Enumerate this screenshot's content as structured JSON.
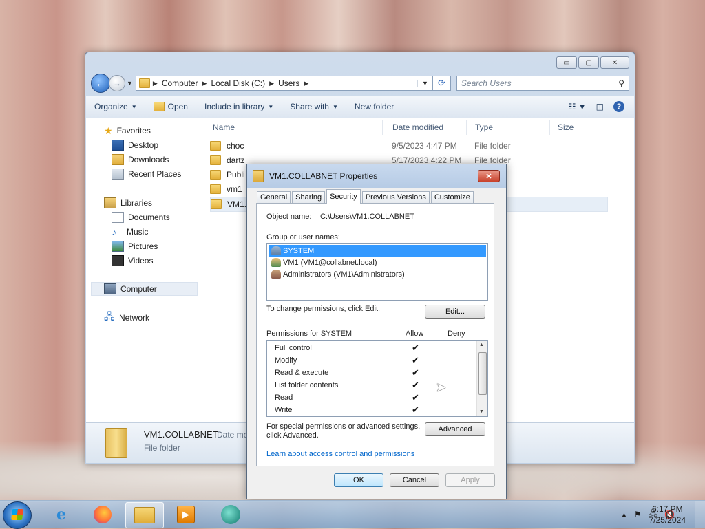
{
  "explorer": {
    "window_buttons": {
      "minimize": "▭",
      "maximize": "▢",
      "close": "✕"
    },
    "address": {
      "segments": [
        "Computer",
        "Local Disk (C:)",
        "Users"
      ]
    },
    "search": {
      "placeholder": "Search Users"
    },
    "toolbar": {
      "organize": "Organize",
      "open": "Open",
      "include_in_library": "Include in library",
      "share_with": "Share with",
      "new_folder": "New folder"
    },
    "nav": {
      "favorites": "Favorites",
      "desktop": "Desktop",
      "downloads": "Downloads",
      "recent_places": "Recent Places",
      "libraries": "Libraries",
      "documents": "Documents",
      "music": "Music",
      "pictures": "Pictures",
      "videos": "Videos",
      "computer": "Computer",
      "network": "Network"
    },
    "columns": {
      "name": "Name",
      "date": "Date modified",
      "type": "Type",
      "size": "Size"
    },
    "files": [
      {
        "name": "choc",
        "date": "9/5/2023 4:47 PM",
        "type": "File folder"
      },
      {
        "name": "dartz",
        "date": "5/17/2023 4:22 PM",
        "type": "File folder"
      },
      {
        "name": "Publi",
        "date": "",
        "type": "er"
      },
      {
        "name": "vm1",
        "date": "",
        "type": "er"
      },
      {
        "name": "VM1.C",
        "date": "",
        "type": "er"
      }
    ],
    "details": {
      "name": "VM1.COLLABNET",
      "date_label": "Date mo",
      "type": "File folder"
    }
  },
  "dialog": {
    "title": "VM1.COLLABNET Properties",
    "close": "✕",
    "tabs": [
      "General",
      "Sharing",
      "Security",
      "Previous Versions",
      "Customize"
    ],
    "object_name_label": "Object name:",
    "object_name": "C:\\Users\\VM1.COLLABNET",
    "group_label": "Group or user names:",
    "users": [
      "SYSTEM",
      "VM1 (VM1@collabnet.local)",
      "Administrators (VM1\\Administrators)"
    ],
    "change_text": "To change permissions, click Edit.",
    "edit_button": "Edit...",
    "permissions_for": "Permissions for SYSTEM",
    "allow": "Allow",
    "deny": "Deny",
    "permissions": [
      {
        "name": "Full control",
        "allow": "✔"
      },
      {
        "name": "Modify",
        "allow": "✔"
      },
      {
        "name": "Read & execute",
        "allow": "✔"
      },
      {
        "name": "List folder contents",
        "allow": "✔"
      },
      {
        "name": "Read",
        "allow": "✔"
      },
      {
        "name": "Write",
        "allow": "✔"
      }
    ],
    "special_text_1": "For special permissions or advanced settings,",
    "special_text_2": "click Advanced.",
    "advanced_button": "Advanced",
    "learn_link": "Learn about access control and permissions",
    "ok": "OK",
    "cancel": "Cancel",
    "apply": "Apply"
  },
  "taskbar": {
    "time": "6:17 PM",
    "date": "7/25/2024",
    "tray_arrow": "▲"
  }
}
